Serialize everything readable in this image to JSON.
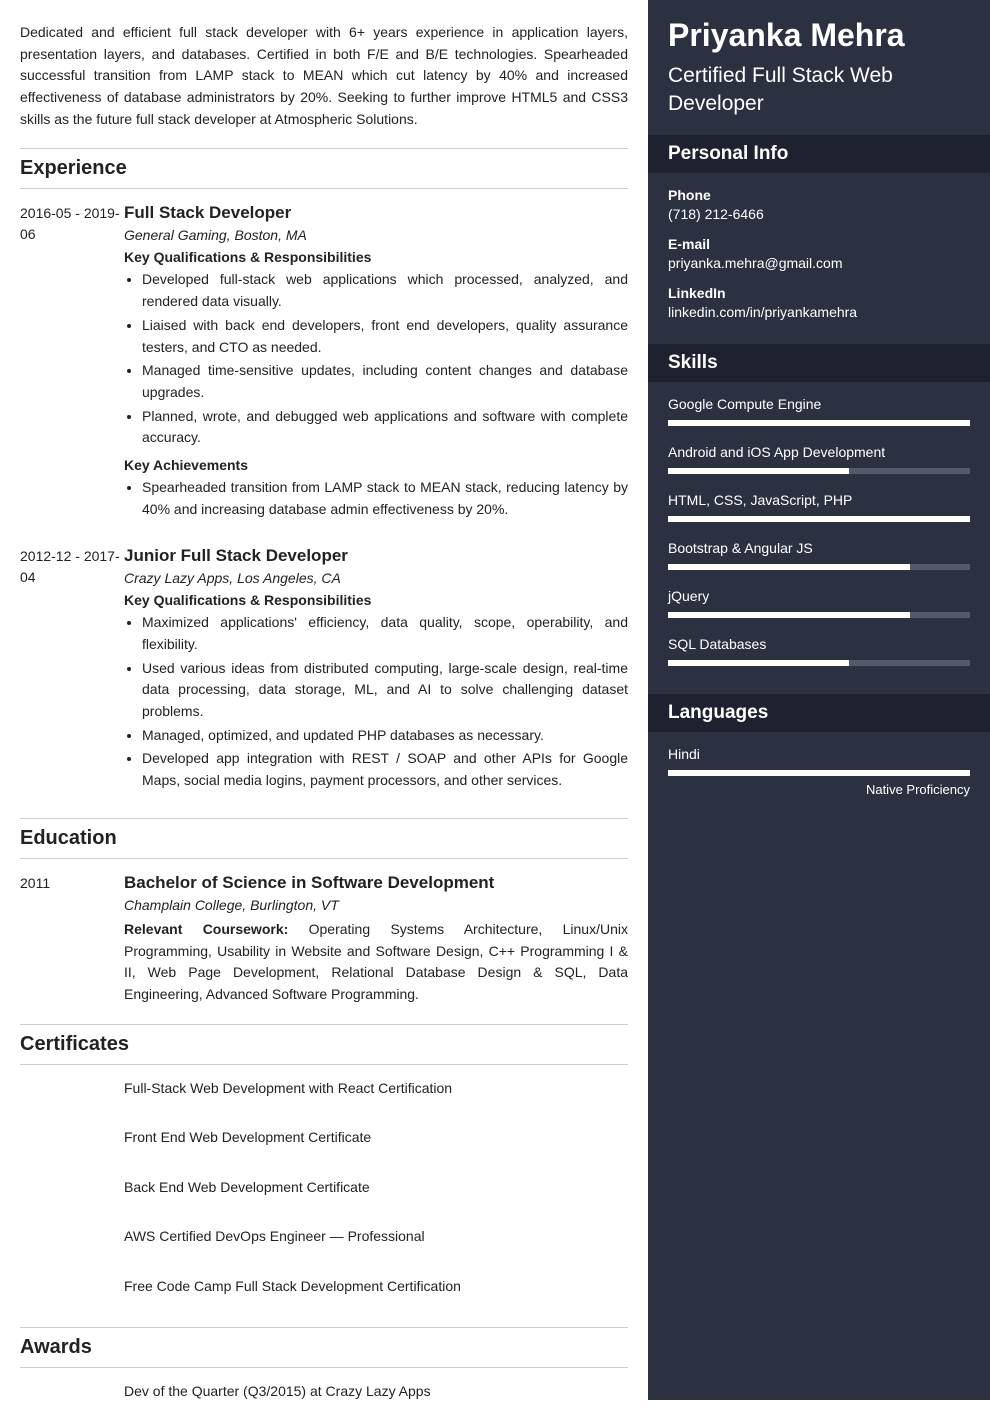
{
  "summary": "Dedicated and efficient full stack developer with 6+ years experience in application layers, presentation layers, and databases. Certified in both F/E and B/E technologies. Spearheaded successful transition from LAMP stack to MEAN which cut latency by 40% and increased effectiveness of database administrators by 20%. Seeking to further improve HTML5 and CSS3 skills as the future full stack developer at Atmospheric Solutions.",
  "sections": {
    "experience": "Experience",
    "education": "Education",
    "certificates": "Certificates",
    "awards": "Awards",
    "personal": "Personal Info",
    "skills": "Skills",
    "languages": "Languages"
  },
  "experience": [
    {
      "dates": "2016-05 - 2019-06",
      "title": "Full Stack Developer",
      "company": "General Gaming, Boston, MA",
      "resp_head": "Key Qualifications & Responsibilities",
      "resp": [
        "Developed full-stack web applications which processed, analyzed, and rendered data visually.",
        "Liaised with back end developers, front end developers, quality assurance testers, and CTO as needed.",
        "Managed time-sensitive updates, including content changes and database upgrades.",
        "Planned, wrote, and debugged web applications and software with complete accuracy."
      ],
      "ach_head": "Key Achievements",
      "ach": [
        "Spearheaded transition from LAMP stack to MEAN stack, reducing latency by 40% and increasing database admin effectiveness by 20%."
      ]
    },
    {
      "dates": "2012-12 - 2017-04",
      "title": "Junior Full Stack Developer",
      "company": "Crazy Lazy Apps, Los Angeles, CA",
      "resp_head": "Key Qualifications & Responsibilities",
      "resp": [
        "Maximized applications' efficiency, data quality, scope, operability, and flexibility.",
        "Used various ideas from distributed computing, large-scale design, real-time data processing, data storage, ML, and AI to solve challenging dataset problems.",
        "Managed, optimized, and updated PHP databases as necessary.",
        "Developed app integration with REST / SOAP and other APIs for Google Maps, social media logins, payment processors, and other services."
      ]
    }
  ],
  "education": {
    "year": "2011",
    "degree": "Bachelor of Science in Software Development",
    "school": "Champlain College, Burlington, VT",
    "coursework_label": "Relevant Coursework:",
    "coursework": "Operating Systems Architecture, Linux/Unix Programming, Usability in Website and Software Design, C++ Programming I & II, Web Page Development, Relational Database Design & SQL, Data Engineering, Advanced Software Programming."
  },
  "certificates": [
    "Full-Stack Web Development with React Certification",
    "Front End Web Development Certificate",
    "Back End Web Development Certificate",
    "AWS Certified DevOps Engineer — Professional",
    "Free Code Camp Full Stack Development Certification"
  ],
  "awards": [
    "Dev of the Quarter (Q3/2015) at Crazy Lazy Apps"
  ],
  "name": "Priyanka Mehra",
  "role": "Certified Full Stack Web Developer",
  "personal": {
    "phone_label": "Phone",
    "phone": "(718) 212-6466",
    "email_label": "E-mail",
    "email": "priyanka.mehra@gmail.com",
    "linkedin_label": "LinkedIn",
    "linkedin": "linkedin.com/in/priyankamehra"
  },
  "skills": [
    {
      "name": "Google Compute Engine",
      "level": 100
    },
    {
      "name": "Android and iOS App Development",
      "level": 60
    },
    {
      "name": "HTML, CSS, JavaScript, PHP",
      "level": 100
    },
    {
      "name": "Bootstrap & Angular JS",
      "level": 80
    },
    {
      "name": "jQuery",
      "level": 80
    },
    {
      "name": "SQL Databases",
      "level": 60
    }
  ],
  "languages": [
    {
      "name": "Hindi",
      "level": 100,
      "label": "Native Proficiency"
    }
  ]
}
